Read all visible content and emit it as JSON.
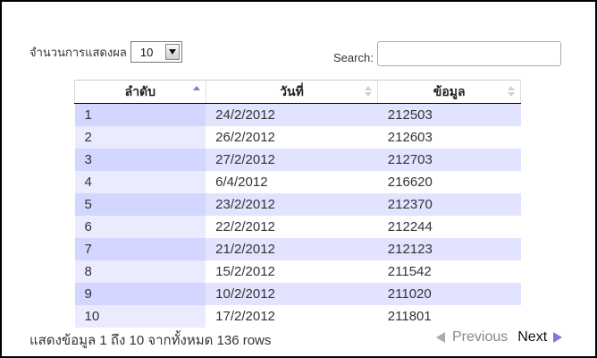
{
  "length_menu": {
    "label": "จำนวนการแสดงผล",
    "selected": "10"
  },
  "search": {
    "label": "Search:",
    "value": "",
    "placeholder": ""
  },
  "table": {
    "headers": [
      "ลำดับ",
      "วันที่",
      "ข้อมูล"
    ],
    "sorted_column": "ลำดับ",
    "sort_direction": "ascending",
    "rows": [
      [
        "1",
        "24/2/2012",
        "212503"
      ],
      [
        "2",
        "26/2/2012",
        "212603"
      ],
      [
        "3",
        "27/2/2012",
        "212703"
      ],
      [
        "4",
        "6/4/2012",
        "216620"
      ],
      [
        "5",
        "23/2/2012",
        "212370"
      ],
      [
        "6",
        "22/2/2012",
        "212244"
      ],
      [
        "7",
        "21/2/2012",
        "212123"
      ],
      [
        "8",
        "15/2/2012",
        "211542"
      ],
      [
        "9",
        "10/2/2012",
        "211020"
      ],
      [
        "10",
        "17/2/2012",
        "211801"
      ]
    ]
  },
  "info": "แสดงข้อมูล 1 ถึง 10 จากทั้งหมด 136 rows",
  "pagination": {
    "previous": "Previous",
    "next": "Next"
  },
  "colors": {
    "odd_row": "#e2e4ff",
    "sorted_odd": "#d3d6ff",
    "sorted_even": "#eaebff",
    "sort_arrow": "#7c7cd8"
  }
}
